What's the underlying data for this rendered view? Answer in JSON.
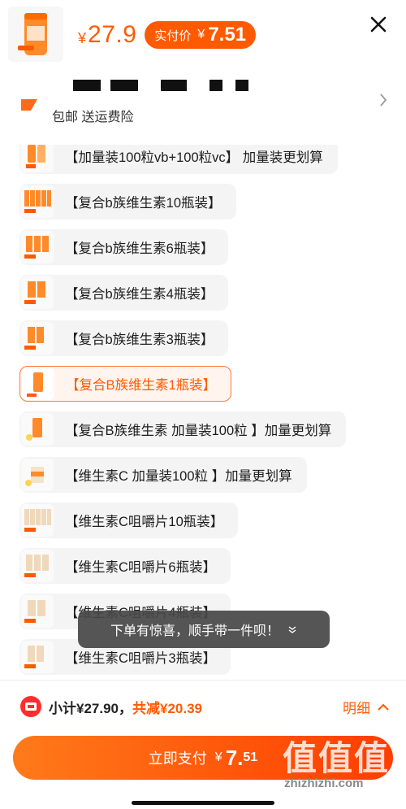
{
  "header": {
    "price_symbol": "¥",
    "price": "27.9",
    "pay_label": "实付价",
    "pay_symbol": "¥",
    "pay_value": "7.51",
    "shipping_text": "包邮 送运费险"
  },
  "options": [
    {
      "label": "【加量装100粒vb+100粒vc】 加量装更划算",
      "thumb_tag": "24",
      "selected": false
    },
    {
      "label": "【复合b族维生素10瓶装】",
      "thumb_tag": "79",
      "selected": false
    },
    {
      "label": "【复合b族维生素6瓶装】",
      "thumb_tag": "47",
      "selected": false
    },
    {
      "label": "【复合b族维生素4瓶装】",
      "thumb_tag": "29",
      "selected": false
    },
    {
      "label": "【复合b族维生素3瓶装】",
      "thumb_tag": "24",
      "selected": false
    },
    {
      "label": "【复合B族维生素1瓶装】",
      "thumb_tag": "",
      "selected": true
    },
    {
      "label": "【复合B族维生素 加量装100粒 】加量更划算",
      "thumb_tag": "",
      "selected": false
    },
    {
      "label": "【维生素C 加量装100粒 】加量更划算",
      "thumb_tag": "",
      "selected": false
    },
    {
      "label": "【维生素C咀嚼片10瓶装】",
      "thumb_tag": "79",
      "selected": false
    },
    {
      "label": "【维生素C咀嚼片6瓶装】",
      "thumb_tag": "47",
      "selected": false
    },
    {
      "label": "【维生素C咀嚼片4瓶装】",
      "thumb_tag": "29",
      "selected": false
    },
    {
      "label": "【维生素C咀嚼片3瓶装】",
      "thumb_tag": "24",
      "selected": false
    }
  ],
  "toast": {
    "text": "下单有惊喜，顺手带一件呗！"
  },
  "footer": {
    "subtotal_label": "小计¥27.90，",
    "discount_label": "共减¥20.39",
    "detail_label": "明细",
    "pay_button_label": "立即支付",
    "pay_symbol": "¥",
    "pay_big": "7.",
    "pay_small": "51"
  },
  "watermark": {
    "chars": "值值值",
    "url": "zhizhizhi.com"
  },
  "colors": {
    "accent": "#ff5a00",
    "selected_bg": "#fff4ee",
    "option_bg": "#f4f4f4"
  }
}
